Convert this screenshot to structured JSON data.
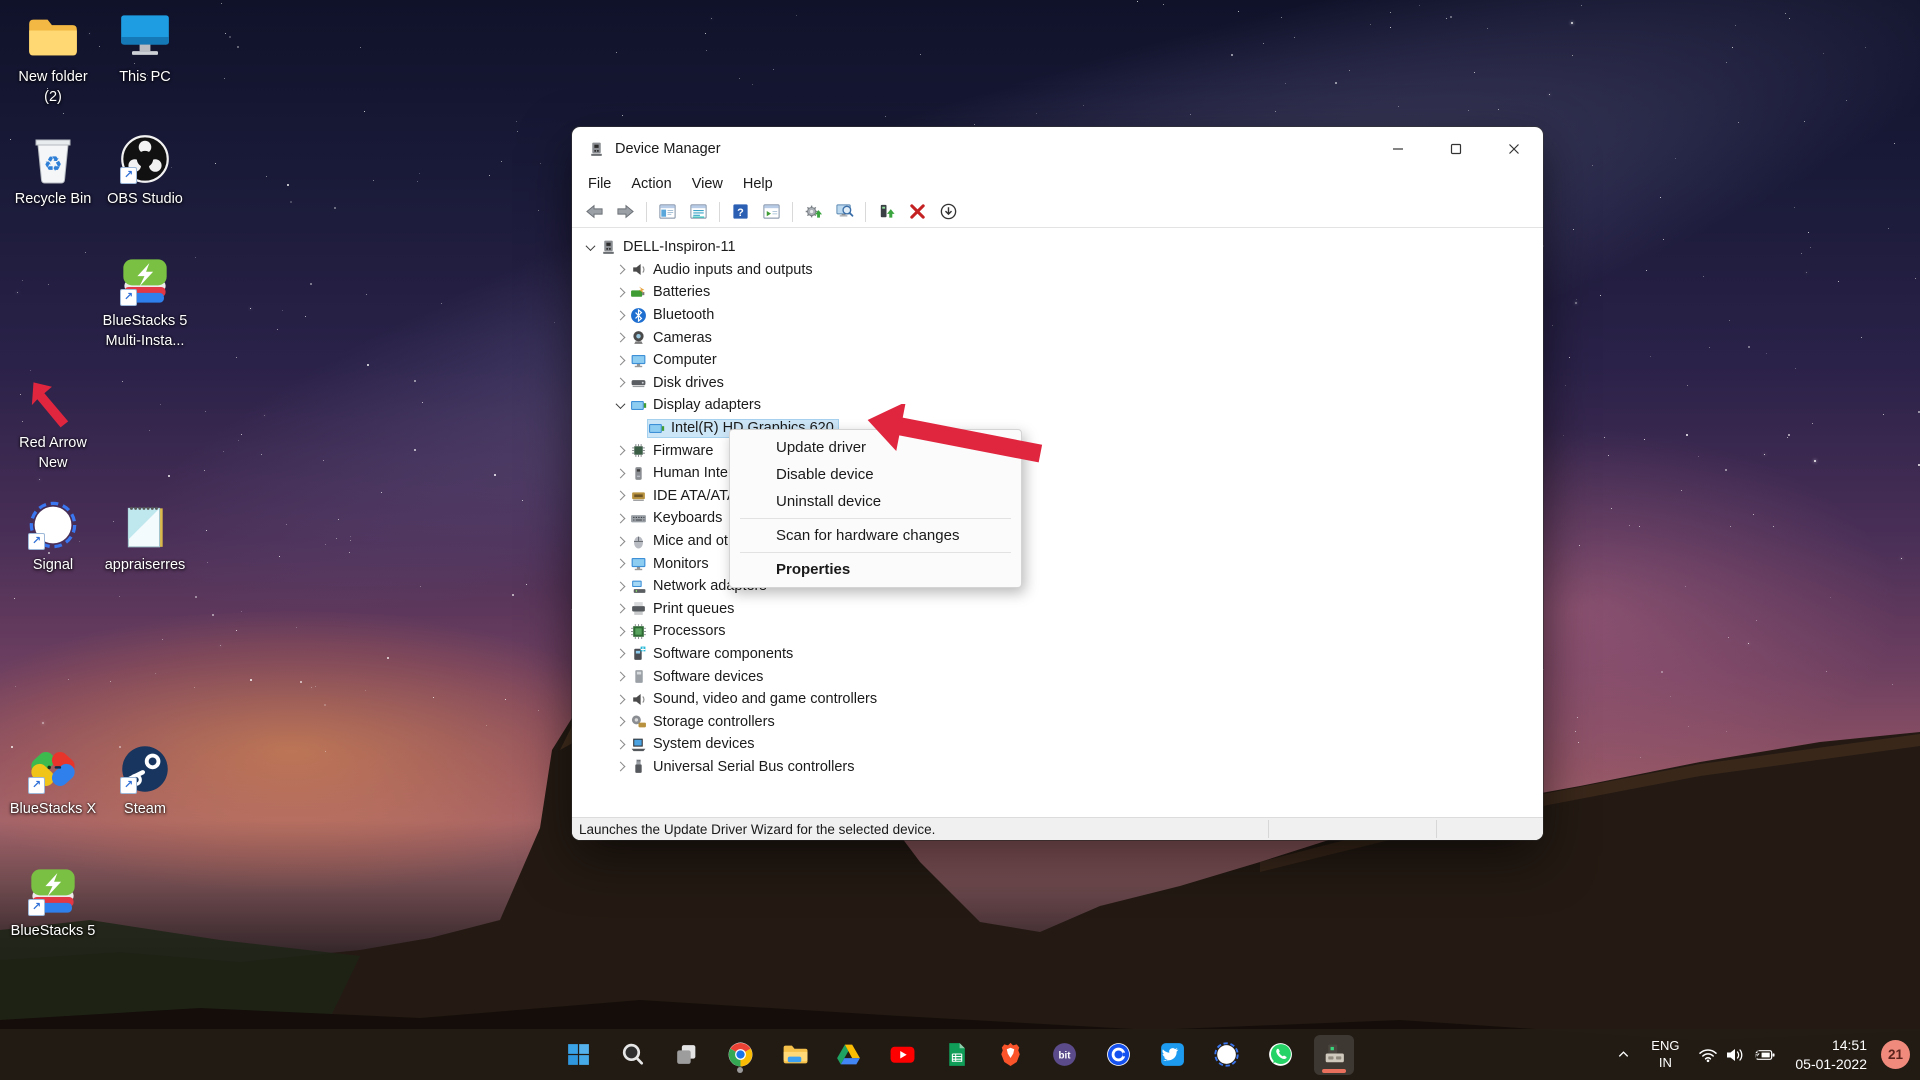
{
  "colors": {
    "annotation_arrow": "#e0263f",
    "selection": "#cde6f7",
    "taskbar_badge_bg": "#ef8a7c",
    "active_underline": "#e8705c"
  },
  "desktop": {
    "icons": [
      {
        "name": "new-folder-2",
        "label": "New folder\n(2)",
        "icon": "folder",
        "shortcut": false,
        "col": 0,
        "row": 0
      },
      {
        "name": "this-pc",
        "label": "This PC",
        "icon": "thispc",
        "shortcut": false,
        "col": 1,
        "row": 0
      },
      {
        "name": "recycle-bin",
        "label": "Recycle Bin",
        "icon": "recycle",
        "shortcut": false,
        "col": 0,
        "row": 1
      },
      {
        "name": "obs-studio",
        "label": "OBS Studio",
        "icon": "obs",
        "shortcut": true,
        "col": 1,
        "row": 1
      },
      {
        "name": "bluestacks5-multi",
        "label": "BlueStacks 5\nMulti-Insta...",
        "icon": "bluestacks5",
        "shortcut": true,
        "col": 1,
        "row": 2
      },
      {
        "name": "red-arrow-new",
        "label": "Red Arrow\nNew",
        "icon": "redarrow",
        "shortcut": false,
        "col": 0,
        "row": 3
      },
      {
        "name": "signal",
        "label": "Signal",
        "icon": "signal",
        "shortcut": true,
        "col": 0,
        "row": 4
      },
      {
        "name": "appraiserres",
        "label": "appraiserres",
        "icon": "notepad",
        "shortcut": false,
        "col": 1,
        "row": 4
      },
      {
        "name": "bluestacks-x",
        "label": "BlueStacks X",
        "icon": "bluestacksx",
        "shortcut": true,
        "col": 0,
        "row": 6
      },
      {
        "name": "steam",
        "label": "Steam",
        "icon": "steam",
        "shortcut": true,
        "col": 1,
        "row": 6
      },
      {
        "name": "bluestacks-5",
        "label": "BlueStacks 5",
        "icon": "bluestacks5",
        "shortcut": true,
        "col": 0,
        "row": 7
      }
    ]
  },
  "window": {
    "title": "Device Manager",
    "controls": [
      "minimize",
      "maximize",
      "close"
    ],
    "menus": [
      "File",
      "Action",
      "View",
      "Help"
    ],
    "toolbar": [
      [
        "back",
        "forward"
      ],
      [
        "console-panel",
        "properties"
      ],
      [
        "help",
        "show-window"
      ],
      [
        "update-driver",
        "scan-hardware"
      ],
      [
        "device-update",
        "uninstall-device",
        "disable-device"
      ]
    ],
    "tree": [
      {
        "label": "DELL-Inspiron-11",
        "icon": "pcroot",
        "level": 0,
        "state": "expanded"
      },
      {
        "label": "Audio inputs and outputs",
        "icon": "audio",
        "level": 1,
        "state": "collapsed"
      },
      {
        "label": "Batteries",
        "icon": "battery",
        "level": 1,
        "state": "collapsed"
      },
      {
        "label": "Bluetooth",
        "icon": "bluetooth",
        "level": 1,
        "state": "collapsed"
      },
      {
        "label": "Cameras",
        "icon": "camera",
        "level": 1,
        "state": "collapsed"
      },
      {
        "label": "Computer",
        "icon": "monitor",
        "level": 1,
        "state": "collapsed"
      },
      {
        "label": "Disk drives",
        "icon": "disk",
        "level": 1,
        "state": "collapsed"
      },
      {
        "label": "Display adapters",
        "icon": "display",
        "level": 1,
        "state": "expanded"
      },
      {
        "label": "Intel(R) HD Graphics 620",
        "icon": "display",
        "level": 2,
        "state": "leaf",
        "selected": true
      },
      {
        "label": "Firmware",
        "icon": "firmware",
        "level": 1,
        "state": "collapsed"
      },
      {
        "label": "Human Interface Devices",
        "icon": "hid",
        "level": 1,
        "state": "collapsed"
      },
      {
        "label": "IDE ATA/ATAPI controllers",
        "icon": "ide",
        "level": 1,
        "state": "collapsed"
      },
      {
        "label": "Keyboards",
        "icon": "keyboard",
        "level": 1,
        "state": "collapsed"
      },
      {
        "label": "Mice and other pointing devices",
        "icon": "mouse",
        "level": 1,
        "state": "collapsed"
      },
      {
        "label": "Monitors",
        "icon": "monitor",
        "level": 1,
        "state": "collapsed"
      },
      {
        "label": "Network adapters",
        "icon": "network",
        "level": 1,
        "state": "collapsed"
      },
      {
        "label": "Print queues",
        "icon": "printer",
        "level": 1,
        "state": "collapsed"
      },
      {
        "label": "Processors",
        "icon": "processor",
        "level": 1,
        "state": "collapsed"
      },
      {
        "label": "Software components",
        "icon": "swcomp",
        "level": 1,
        "state": "collapsed"
      },
      {
        "label": "Software devices",
        "icon": "swdev",
        "level": 1,
        "state": "collapsed"
      },
      {
        "label": "Sound, video and game controllers",
        "icon": "audio",
        "level": 1,
        "state": "collapsed"
      },
      {
        "label": "Storage controllers",
        "icon": "storage",
        "level": 1,
        "state": "collapsed"
      },
      {
        "label": "System devices",
        "icon": "system",
        "level": 1,
        "state": "collapsed"
      },
      {
        "label": "Universal Serial Bus controllers",
        "icon": "usb",
        "level": 1,
        "state": "collapsed"
      }
    ],
    "context_menu": {
      "items": [
        {
          "label": "Update driver"
        },
        {
          "label": "Disable device"
        },
        {
          "label": "Uninstall device"
        },
        {
          "separator": true
        },
        {
          "label": "Scan for hardware changes"
        },
        {
          "separator": true
        },
        {
          "label": "Properties",
          "bold": true
        }
      ]
    },
    "status": "Launches the Update Driver Wizard for the selected device."
  },
  "taskbar": {
    "items": [
      {
        "name": "start",
        "icon": "start"
      },
      {
        "name": "search",
        "icon": "search"
      },
      {
        "name": "task-view",
        "icon": "taskview"
      },
      {
        "name": "chrome",
        "icon": "chrome",
        "running": true
      },
      {
        "name": "file-explorer",
        "icon": "explorer"
      },
      {
        "name": "google-drive",
        "icon": "gdrive"
      },
      {
        "name": "youtube",
        "icon": "youtube"
      },
      {
        "name": "google-sheets",
        "icon": "sheets"
      },
      {
        "name": "brave",
        "icon": "brave"
      },
      {
        "name": "bit-app",
        "icon": "bit"
      },
      {
        "name": "coinbase",
        "icon": "coinbase"
      },
      {
        "name": "twitter",
        "icon": "twitter"
      },
      {
        "name": "signal",
        "icon": "signaltb"
      },
      {
        "name": "whatsapp",
        "icon": "whatsapp"
      },
      {
        "name": "device-manager",
        "icon": "devmgr",
        "active": true
      }
    ],
    "tray": {
      "language_line1": "ENG",
      "language_line2": "IN",
      "time": "14:51",
      "date": "05-01-2022",
      "badge": "21"
    }
  }
}
